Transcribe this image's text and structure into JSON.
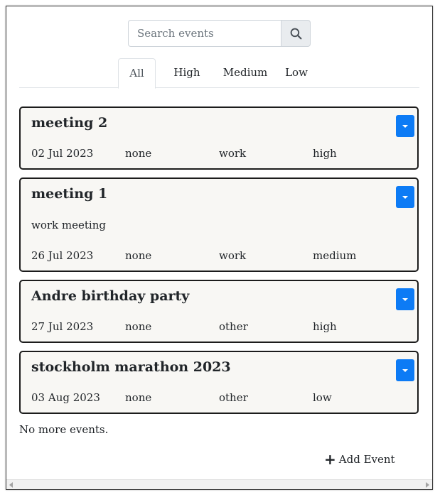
{
  "search": {
    "placeholder": "Search events",
    "value": ""
  },
  "tabs": [
    {
      "label": "All",
      "active": true
    },
    {
      "label": "High",
      "active": false
    },
    {
      "label": "Medium",
      "active": false
    },
    {
      "label": "Low",
      "active": false
    }
  ],
  "events": [
    {
      "title": "meeting 2",
      "description": "",
      "date": "02 Jul 2023",
      "repeat": "none",
      "category": "work",
      "priority": "high"
    },
    {
      "title": "meeting 1",
      "description": "work meeting",
      "date": "26 Jul 2023",
      "repeat": "none",
      "category": "work",
      "priority": "medium"
    },
    {
      "title": "Andre birthday party",
      "description": "",
      "date": "27 Jul 2023",
      "repeat": "none",
      "category": "other",
      "priority": "high"
    },
    {
      "title": "stockholm marathon 2023",
      "description": "",
      "date": "03 Aug 2023",
      "repeat": "none",
      "category": "other",
      "priority": "low"
    }
  ],
  "footer": {
    "no_more": "No more events.",
    "add_event_label": "Add Event"
  },
  "colors": {
    "dropdown_button": "#0d7bf5",
    "card_background": "#f8f7f4",
    "card_border": "#1c1c1c"
  },
  "icons": {
    "search": "search-icon",
    "dropdown": "caret-down-icon",
    "add": "plus-icon"
  }
}
